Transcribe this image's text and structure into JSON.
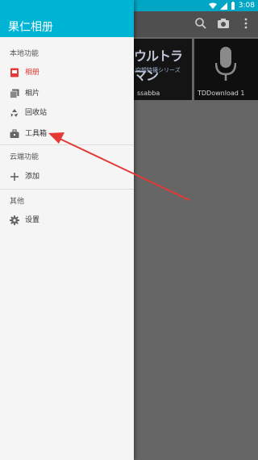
{
  "status_bar": {
    "time": "3:08"
  },
  "drawer": {
    "title": "果仁相册",
    "sections": [
      {
        "label": "本地功能",
        "items": [
          {
            "label": "相册"
          },
          {
            "label": "相片"
          },
          {
            "label": "回收站"
          },
          {
            "label": "工具箱"
          }
        ]
      },
      {
        "label": "云端功能",
        "items": [
          {
            "label": "添加"
          }
        ]
      },
      {
        "label": "其他",
        "items": [
          {
            "label": "设置"
          }
        ]
      }
    ]
  },
  "gallery": {
    "thumbs": [
      {
        "caption": "ssabba",
        "art_text": "ウルトラマン",
        "art_sub": "空想特撮シリーズ"
      },
      {
        "caption": "TDDownload 1"
      }
    ]
  },
  "colors": {
    "accent": "#00b4d6",
    "status_bar": "#00a6c4",
    "active_item": "#e53935",
    "annotation_arrow": "#e53935"
  },
  "icons": {
    "status": [
      "wifi-icon",
      "signal-icon",
      "battery-icon"
    ],
    "appbar": [
      "search-icon",
      "camera-icon",
      "more-vert-icon"
    ],
    "drawer": [
      "album-icon",
      "photo-icon",
      "recycle-icon",
      "toolbox-icon",
      "add-icon",
      "gear-icon"
    ]
  }
}
